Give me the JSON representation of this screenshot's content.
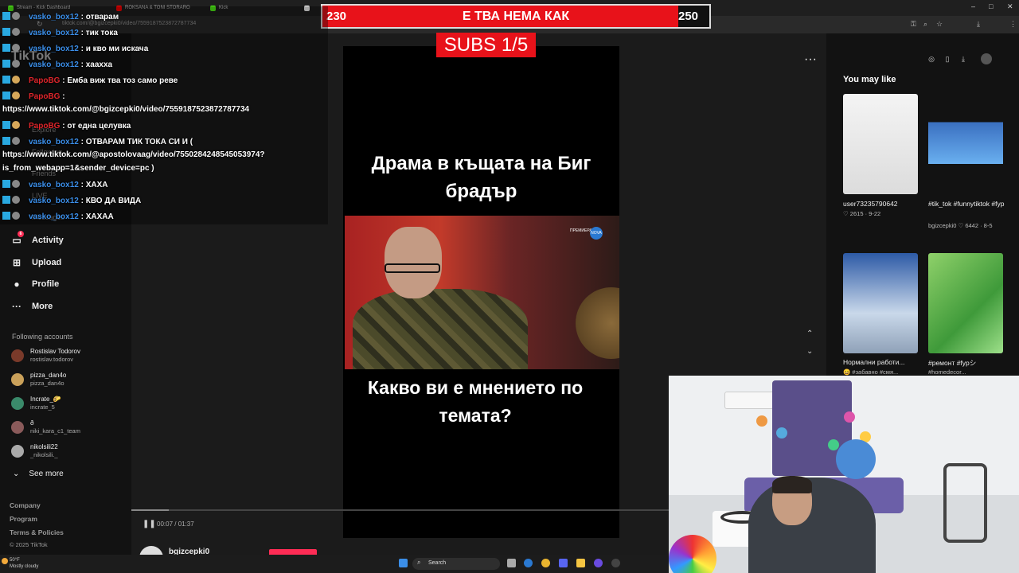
{
  "browser": {
    "tabs": [
      {
        "label": "Stream - Kick Dashboard",
        "color": "#53fc18"
      },
      {
        "label": "ROKSANA & TONI STORARO",
        "color": "#ff0000"
      },
      {
        "label": "Kick",
        "color": "#53fc18"
      },
      {
        "label": "",
        "color": "#ffffff"
      }
    ],
    "url": "tiktok.com/@bgizcepki0/video/7559187523872787734",
    "window_controls": [
      "–",
      "□",
      "✕"
    ]
  },
  "stream_overlay": {
    "goal_current": "230",
    "goal_target": "250",
    "goal_title": "Е ТВА НЕМА КАК",
    "goal_progress": 0.92,
    "subs_label": "SUBS 1/5"
  },
  "chat": [
    {
      "user": "vasko_box12",
      "color": "user-blue",
      "msg": ": отварам"
    },
    {
      "user": "vasko_box12",
      "color": "user-blue",
      "msg": ": тик тока"
    },
    {
      "user": "vasko_box12",
      "color": "user-blue",
      "msg": ": и кво ми искача"
    },
    {
      "user": "vasko_box12",
      "color": "user-blue",
      "msg": ": хаахха"
    },
    {
      "user": "PapoBG",
      "color": "user-red",
      "msg": ": Емба виж тва тоз само реве"
    },
    {
      "user": "PapoBG",
      "color": "user-red",
      "msg": ":"
    },
    {
      "user": "",
      "color": "",
      "msg": "https://www.tiktok.com/@bgizcepki0/video/7559187523872787734"
    },
    {
      "user": "PapoBG",
      "color": "user-red",
      "msg": ": от една целувка"
    },
    {
      "user": "vasko_box12",
      "color": "user-blue",
      "msg": ": ОТВАРАМ ТИК ТОКА СИ И ("
    },
    {
      "user": "",
      "color": "",
      "msg": "https://www.tiktok.com/@apostolovaag/video/7550284248545053974?"
    },
    {
      "user": "",
      "color": "",
      "msg": "is_from_webapp=1&sender_device=pc )"
    },
    {
      "user": "vasko_box12",
      "color": "user-blue",
      "msg": ": ХАХА"
    },
    {
      "user": "vasko_box12",
      "color": "user-blue",
      "msg": ": КВО ДА ВИДА"
    },
    {
      "user": "vasko_box12",
      "color": "user-blue",
      "msg": ": ХАХАА"
    }
  ],
  "sidebar": {
    "logo": "TikTok",
    "ghost_items": [
      "Explore",
      "Following",
      "Friends",
      "LIVE",
      "Messages"
    ],
    "nav": [
      {
        "label": "Activity",
        "icon": "activity-icon",
        "glyph": "▭",
        "badge": "6"
      },
      {
        "label": "Upload",
        "icon": "upload-icon",
        "glyph": "⊞",
        "badge": ""
      },
      {
        "label": "Profile",
        "icon": "profile-icon",
        "glyph": "●",
        "badge": ""
      },
      {
        "label": "More",
        "icon": "more-icon",
        "glyph": "···",
        "badge": ""
      }
    ],
    "following_title": "Following accounts",
    "accounts": [
      {
        "name": "Rostislav Todorov",
        "handle": "rostislav.todorov"
      },
      {
        "name": "pizza_dan4o",
        "handle": "pizza_dan4o"
      },
      {
        "name": "Incrate_🌮",
        "handle": "incrate_5"
      },
      {
        "name": "ð",
        "handle": "niki_kara_c1_team"
      },
      {
        "name": "nikolsili22",
        "handle": "_nikolsili._"
      }
    ],
    "see_more": "See more",
    "footer": [
      "Company",
      "Program",
      "Terms & Policies"
    ],
    "copyright": "© 2025 TikTok"
  },
  "video": {
    "top_caption": "Драма в къщата на Биг брадър",
    "bottom_caption": "Какво ви е мнението по темата?",
    "channel_logo": "ПРЕМИЕРА",
    "channel_mark": "NOVA",
    "time": "00:07 / 01:37",
    "progress": 0.07,
    "author": "bgizcepki0"
  },
  "right_panel": {
    "title": "You may like",
    "items": [
      {
        "caption": "user73235790642",
        "sub": "♡ 2615 · 9-22",
        "bg": "linear-gradient(180deg,#f4f4f4,#dcdcdc)"
      },
      {
        "caption": "#tik_tok #funnytiktok #fyp...",
        "sub": "bgizcepki0  ♡ 6442 · 8-5",
        "bg": "linear-gradient(180deg,#121212 0%,#121212 28%,#3a6fc0 28%,#6ab0f0 70%,#121212 70%)"
      },
      {
        "caption": "Нормални работи...",
        "sub": "😄 #забавно #смя...",
        "bg": "linear-gradient(180deg,#2d5aa6,#c9d8ea 60%,#8fa1b8)"
      },
      {
        "caption": "#ремонт #fypシ",
        "sub": "#homedecor...",
        "bg": "linear-gradient(135deg,#8fd16a,#3f9a3a 60%,#9ee08a)"
      }
    ]
  },
  "taskbar": {
    "weather_temp": "50°F",
    "weather_desc": "Mostly cloudy",
    "search": "Search"
  }
}
